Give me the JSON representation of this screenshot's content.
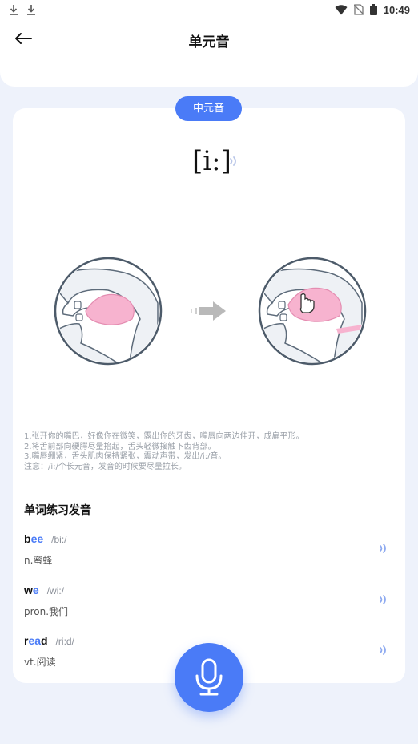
{
  "status_bar": {
    "time": "10:49",
    "left_icons": [
      "download-icon",
      "download-icon"
    ],
    "right_icons": [
      "wifi-icon",
      "no-sim-icon",
      "battery-icon"
    ]
  },
  "header": {
    "title": "单元音",
    "back_icon": "arrow-left-icon"
  },
  "category": "中元音",
  "phonetic_symbol": "[i:]",
  "illustrations": [
    "mouth-before-icon",
    "arrow-right-icon",
    "mouth-after-icon"
  ],
  "instructions": [
    "1.张开你的嘴巴，好像你在微笑，露出你的牙齿，嘴唇向两边伸开，成扁平形。",
    "2.将舌前部向硬腭尽量抬起，舌头轻微接触下齿背部。",
    "3.嘴唇绷紧，舌头肌肉保持紧张，震动声带，发出/i:/音。",
    "注意：/i:/个长元音，发音的时候要尽量拉长。"
  ],
  "practice": {
    "title": "单词练习发音",
    "words": [
      {
        "prefix": "b",
        "highlight": "ee",
        "suffix": "",
        "phonetic": "/bi:/",
        "meaning": "n.蜜蜂"
      },
      {
        "prefix": "w",
        "highlight": "e",
        "suffix": "",
        "phonetic": "/wi:/",
        "meaning": "pron.我们"
      },
      {
        "prefix": "r",
        "highlight": "ea",
        "suffix": "d",
        "phonetic": "/ri:d/",
        "meaning": "vt.阅读"
      }
    ]
  },
  "colors": {
    "accent": "#4a7bf7",
    "background": "#eef2fb",
    "card": "#ffffff",
    "muted_text": "#9aa0a8",
    "mouth_pink": "#f7b3cf",
    "outline": "#4d5b6a"
  },
  "mic_icon": "microphone-icon"
}
